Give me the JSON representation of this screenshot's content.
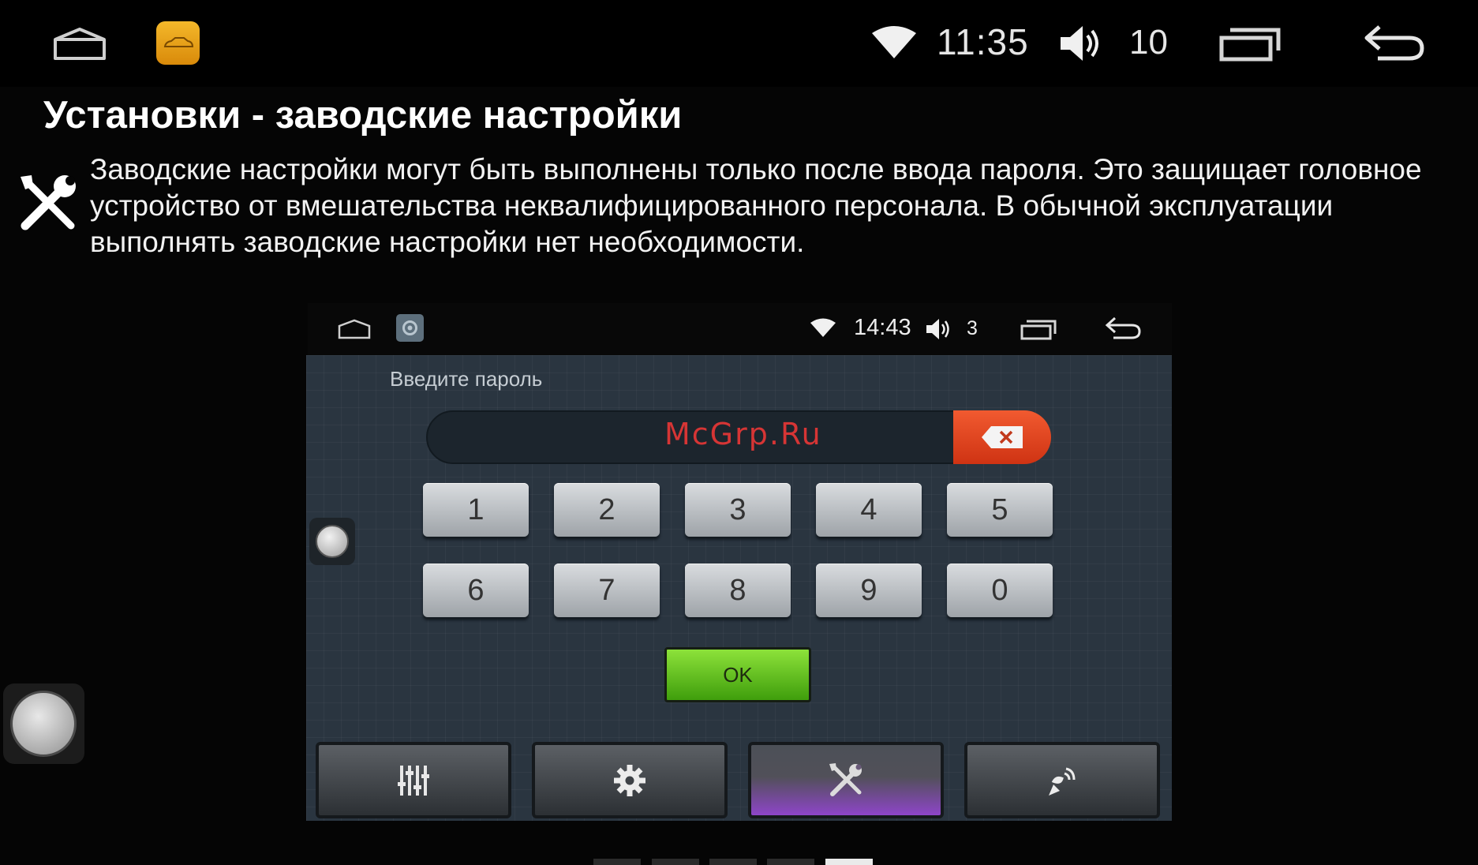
{
  "status_bar": {
    "time": "11:35",
    "volume": "10",
    "icons": [
      "home-icon",
      "car-app-icon",
      "wifi-icon",
      "volume-icon",
      "recents-icon",
      "back-icon"
    ]
  },
  "heading": "Установки - заводские настройки",
  "description": "Заводские настройки могут быть выполнены только после ввода пароля. Это защищает головное устройство от вмешательства неквалифицированного персонала. В обычной эксплуатации выполнять заводские настройки нет необходимости.",
  "device": {
    "status_bar": {
      "time": "14:43",
      "volume": "3"
    },
    "password_label": "Введите пароль",
    "password_value": "",
    "watermark": "McGrp.Ru",
    "keys_row1": [
      "1",
      "2",
      "3",
      "4",
      "5"
    ],
    "keys_row2": [
      "6",
      "7",
      "8",
      "9",
      "0"
    ],
    "ok_label": "OK",
    "tabs": [
      {
        "icon": "equalizer-icon"
      },
      {
        "icon": "gear-icon"
      },
      {
        "icon": "tools-icon",
        "active": true
      },
      {
        "icon": "satellite-icon"
      }
    ]
  },
  "page_dots": {
    "count": 5,
    "active_index": 4
  }
}
